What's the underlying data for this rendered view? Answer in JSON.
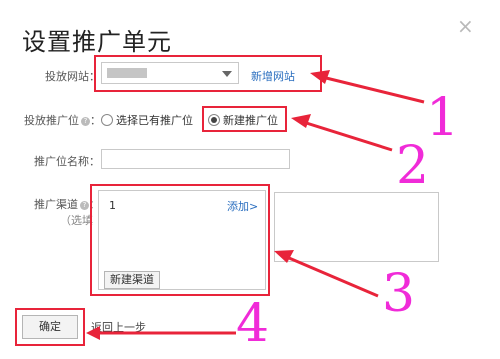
{
  "dialog": {
    "title": "设置推广单元",
    "close_glyph": "×"
  },
  "site_row": {
    "label": "投放网站：",
    "add_link": "新增网站"
  },
  "slot_row": {
    "label": "投放推广位",
    "help_glyph": "?",
    "option_existing": "选择已有推广位",
    "option_new": "新建推广位",
    "selected": "新建推广位"
  },
  "slot_name_row": {
    "label": "推广位名称：",
    "value": ""
  },
  "channel_row": {
    "label": "推广渠道",
    "help_glyph": "?",
    "sub_label": "（选填",
    "item_value": "1",
    "add_link": "添加>",
    "new_channel_button": "新建渠道"
  },
  "footer": {
    "confirm_button": "确定",
    "back_link": "返回上一步"
  },
  "annotations": {
    "numbers": [
      "1",
      "2",
      "3",
      "4"
    ],
    "highlight_color": "#e8243a",
    "number_color": "#f02bd8"
  }
}
